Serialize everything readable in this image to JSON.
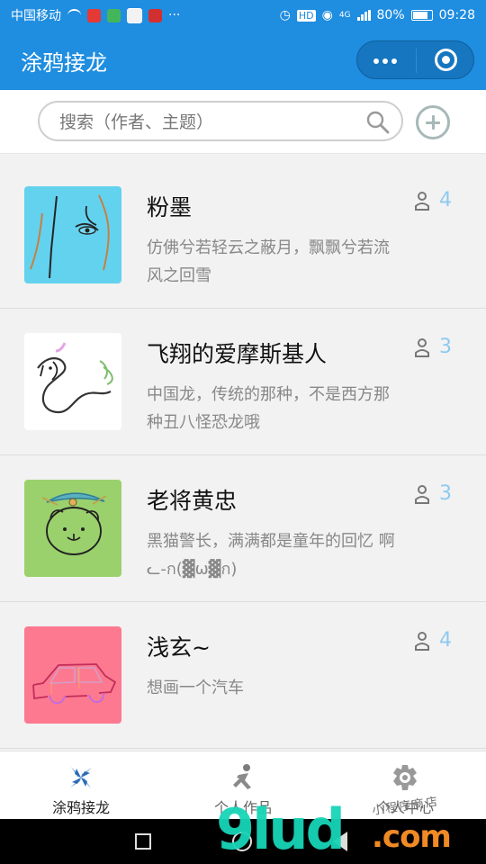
{
  "status": {
    "carrier": "中国移动",
    "network": "4G",
    "battery": "80%",
    "time": "09:28"
  },
  "nav": {
    "title": "涂鸦接龙"
  },
  "search": {
    "placeholder": "搜索（作者、主题）"
  },
  "list": [
    {
      "title": "粉墨",
      "desc": "仿佛兮若轻云之蔽月，飘飘兮若流风之回雪",
      "likes": "4",
      "thumb": "face-sketch"
    },
    {
      "title": "飞翔的爱摩斯基人",
      "desc": "中国龙，传统的那种，不是西方那种丑八怪恐龙哦",
      "likes": "3",
      "thumb": "dragon-sketch"
    },
    {
      "title": "老将黄忠",
      "desc": "黑猫警长，满满都是童年的回忆 啊ᓚ-ก(▓ω▓ก)",
      "likes": "3",
      "thumb": "cat-police-sketch"
    },
    {
      "title": "浅玄~",
      "desc": "想画一个汽车",
      "likes": "4",
      "thumb": "car-sketch"
    }
  ],
  "tabs": [
    {
      "label": "涂鸦接龙",
      "icon": "pinwheel-icon",
      "active": true
    },
    {
      "label": "个人作品",
      "icon": "runner-icon",
      "active": false
    },
    {
      "label": "个人中心",
      "icon": "gear-icon",
      "active": false
    }
  ],
  "watermark": {
    "brand": "9lud",
    "domain": ".com",
    "text": "小程序商店"
  },
  "colors": {
    "primary": "#1f8de0",
    "capsule": "#1676bf",
    "like": "#8ecaf0"
  }
}
